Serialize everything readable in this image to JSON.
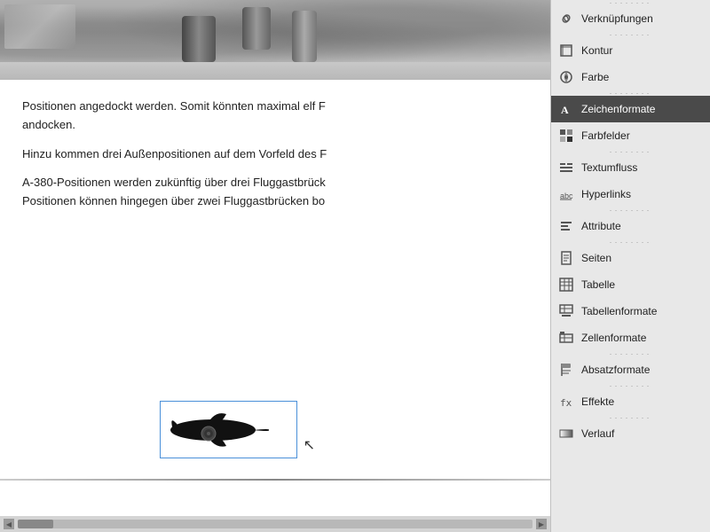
{
  "main": {
    "text1": "Positionen angedockt werden. Somit könnten maximal elf F",
    "text1_cont": "andocken.",
    "text2": "Hinzu kommen drei Außenpositionen auf dem Vorfeld des F",
    "text3": "A-380-Positionen werden zukünftig über drei Fluggastbrück",
    "text3_cont": "Positionen können hingegen über zwei Fluggastbrücken bo"
  },
  "sidebar": {
    "items": [
      {
        "id": "verknuepfungen",
        "label": "Verknüpfungen",
        "icon": "link"
      },
      {
        "id": "kontur",
        "label": "Kontur",
        "icon": "kontur"
      },
      {
        "id": "farbe",
        "label": "Farbe",
        "icon": "farbe"
      },
      {
        "id": "zeichenformate",
        "label": "Zeichenformate",
        "icon": "zeichenformate"
      },
      {
        "id": "farbfelder",
        "label": "Farbfelder",
        "icon": "farbfelder"
      },
      {
        "id": "textumfluss",
        "label": "Textumfluss",
        "icon": "textumfluss"
      },
      {
        "id": "hyperlinks",
        "label": "Hyperlinks",
        "icon": "hyperlinks"
      },
      {
        "id": "attribute",
        "label": "Attribute",
        "icon": "attribute"
      },
      {
        "id": "seiten",
        "label": "Seiten",
        "icon": "seiten"
      },
      {
        "id": "tabelle",
        "label": "Tabelle",
        "icon": "tabelle"
      },
      {
        "id": "tabellenformate",
        "label": "Tabellenformate",
        "icon": "tabellenformate"
      },
      {
        "id": "zellenformate",
        "label": "Zellenformate",
        "icon": "zellenformate"
      },
      {
        "id": "absatzformate",
        "label": "Absatzformate",
        "icon": "absatzformate"
      },
      {
        "id": "effekte",
        "label": "Effekte",
        "icon": "effekte"
      },
      {
        "id": "verlauf",
        "label": "Verlauf",
        "icon": "verlauf"
      }
    ]
  },
  "colors": {
    "active_bg": "#4a4a4a",
    "sidebar_bg": "#e8e8e8",
    "selection_border": "#4a90d9"
  }
}
